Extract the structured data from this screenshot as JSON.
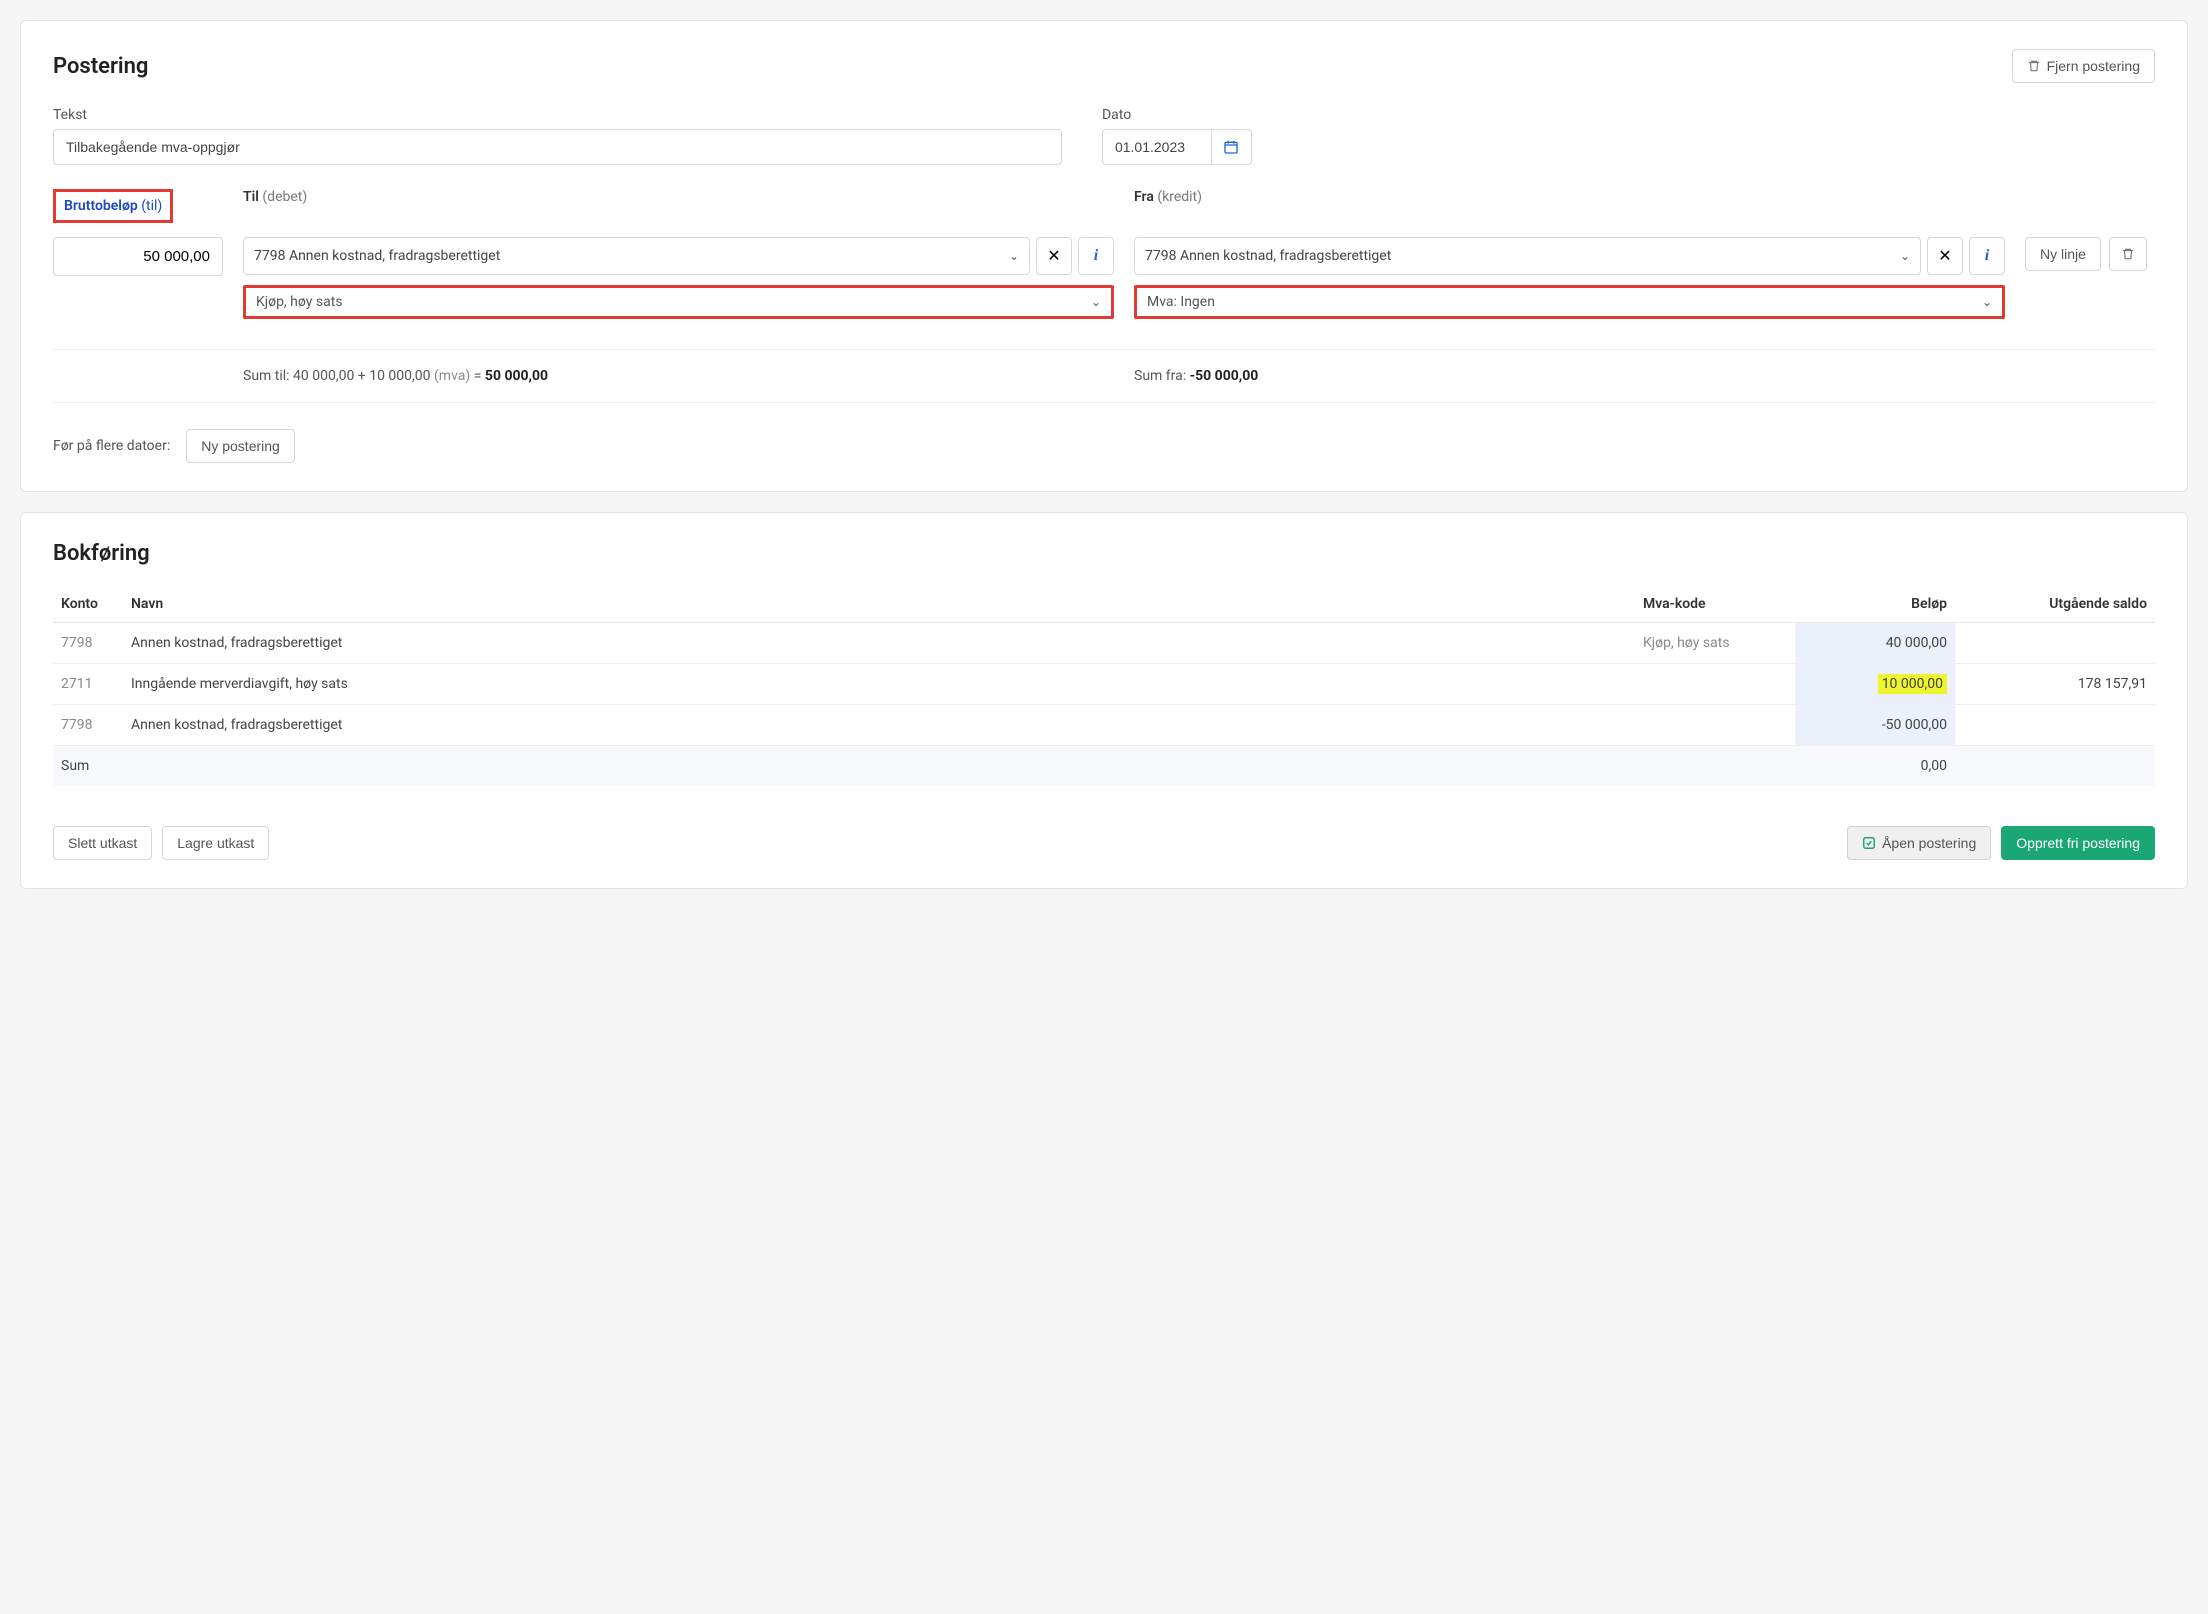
{
  "postering": {
    "title": "Postering",
    "remove_btn": "Fjern postering",
    "tekst_label": "Tekst",
    "tekst_value": "Tilbakegående mva-oppgjør",
    "dato_label": "Dato",
    "dato_value": "01.01.2023",
    "brutto_label": "Bruttobeløp",
    "brutto_sub": "(til)",
    "til_label": "Til",
    "til_sub": "(debet)",
    "fra_label": "Fra",
    "fra_sub": "(kredit)",
    "amount_value": "50 000,00",
    "til_account": "7798 Annen kostnad, fradragsberettiget",
    "fra_account": "7798 Annen kostnad, fradragsberettiget",
    "til_mva": "Kjøp, høy sats",
    "fra_mva": "Mva: Ingen",
    "nylinje_btn": "Ny linje",
    "sum_til_prefix": "Sum til: 40 000,00 + 10 000,00",
    "sum_til_mva": "(mva)",
    "sum_til_eq": " = ",
    "sum_til_total": "50 000,00",
    "sum_fra_prefix": "Sum fra: ",
    "sum_fra_total": "-50 000,00",
    "more_dates_label": "Før på flere datoer:",
    "nypostering_btn": "Ny postering"
  },
  "bokforing": {
    "title": "Bokføring",
    "headers": {
      "konto": "Konto",
      "navn": "Navn",
      "mva": "Mva-kode",
      "belop": "Beløp",
      "saldo": "Utgående saldo"
    },
    "rows": [
      {
        "konto": "7798",
        "navn": "Annen kostnad, fradragsberettiget",
        "mva": "Kjøp, høy sats",
        "belop": "40 000,00",
        "saldo": "",
        "highlight": false
      },
      {
        "konto": "2711",
        "navn": "Inngående merverdiavgift, høy sats",
        "mva": "",
        "belop": "10 000,00",
        "saldo": "178 157,91",
        "highlight": true
      },
      {
        "konto": "7798",
        "navn": "Annen kostnad, fradragsberettiget",
        "mva": "",
        "belop": "-50 000,00",
        "saldo": "",
        "highlight": false
      }
    ],
    "sum_label": "Sum",
    "sum_belop": "0,00"
  },
  "actions": {
    "slett": "Slett utkast",
    "lagre": "Lagre utkast",
    "apen": "Åpen postering",
    "opprett": "Opprett fri postering"
  }
}
